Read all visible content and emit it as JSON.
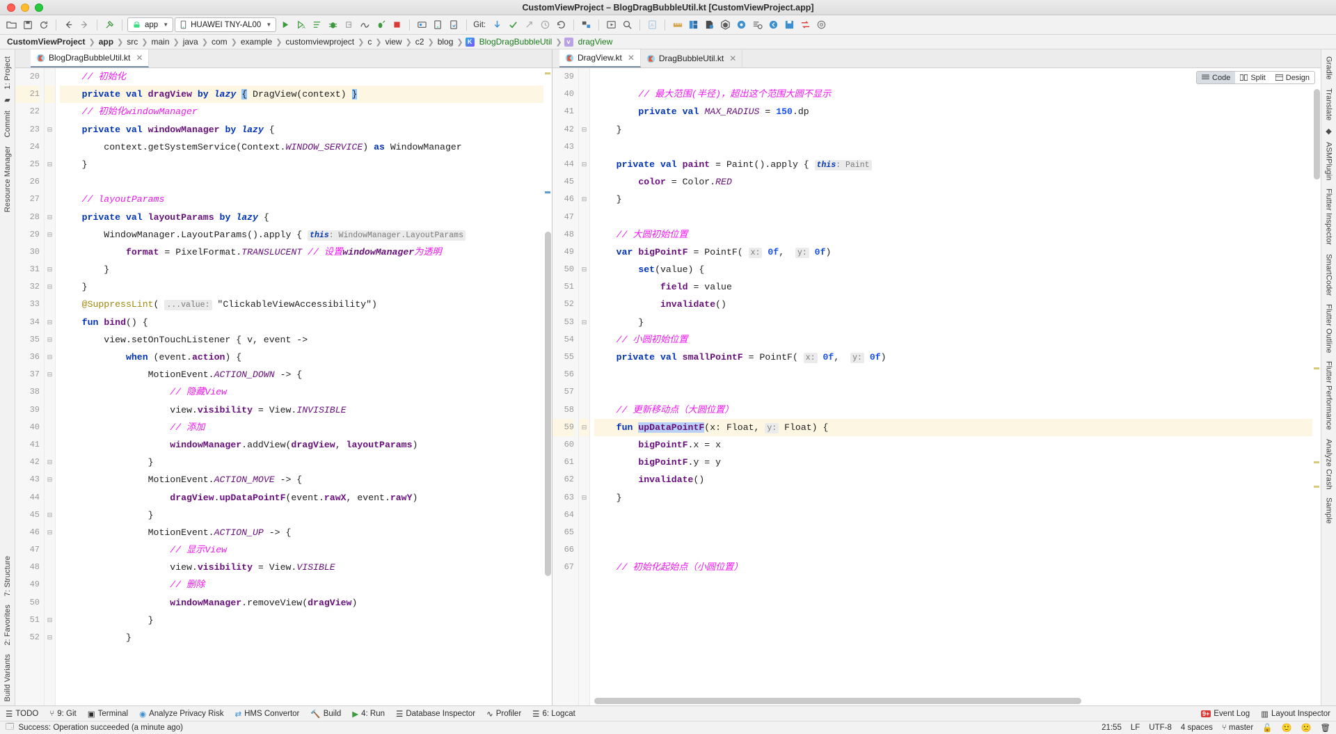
{
  "window": {
    "title": "CustomViewProject – BlogDragBubbleUtil.kt [CustomViewProject.app]"
  },
  "toolbar": {
    "app_config": "app",
    "device": "HUAWEI TNY-AL00",
    "git_label": "Git:",
    "icons": [
      "open-folder-icon",
      "save-all-icon",
      "sync-icon",
      "back-icon",
      "forward-icon",
      "build-hammer-icon",
      "run-icon",
      "run-coverage-icon",
      "run-profile-icon",
      "debug-icon",
      "attach-debugger-icon",
      "profiler-icon",
      "run-with-icon",
      "stop-icon",
      "avd-manager-icon",
      "sdk-manager-icon",
      "device-manager-icon",
      "git-update-icon",
      "git-commit-icon",
      "git-push-icon",
      "git-history-icon",
      "git-revert-icon",
      "project-structure-icon",
      "preview-icon",
      "search-everywhere-icon",
      "layout-editor-icon",
      "ruler-icon",
      "layout-inspector-icon",
      "resource-icon",
      "gradle-icon",
      "help-icon",
      "find-icon",
      "back-nav-icon",
      "save-icon",
      "export-icon",
      "settings-icon"
    ]
  },
  "breadcrumb": {
    "items": [
      {
        "label": "CustomViewProject",
        "bold": true,
        "icon": null
      },
      {
        "label": "app",
        "bold": true,
        "icon": null
      },
      {
        "label": "src",
        "bold": false,
        "icon": null
      },
      {
        "label": "main",
        "bold": false,
        "icon": null
      },
      {
        "label": "java",
        "bold": false,
        "icon": null
      },
      {
        "label": "com",
        "bold": false,
        "icon": null
      },
      {
        "label": "example",
        "bold": false,
        "icon": null
      },
      {
        "label": "customviewproject",
        "bold": false,
        "icon": null
      },
      {
        "label": "c",
        "bold": false,
        "icon": null
      },
      {
        "label": "view",
        "bold": false,
        "icon": null
      },
      {
        "label": "c2",
        "bold": false,
        "icon": null
      },
      {
        "label": "blog",
        "bold": false,
        "icon": null
      },
      {
        "label": "BlogDragBubbleUtil",
        "bold": false,
        "icon": "kotlin-class-icon"
      },
      {
        "label": "dragView",
        "bold": false,
        "icon": "variable-icon"
      }
    ]
  },
  "left_strip": {
    "items": [
      "1: Project",
      "Commit",
      "Resource Manager",
      "7: Structure",
      "2: Favorites",
      "Build Variants"
    ]
  },
  "right_strip": {
    "items": [
      "Gradle",
      "Translate",
      "ASMPlugin",
      "Flutter Inspector",
      "SmartCoder",
      "Flutter Outline",
      "Flutter Performance",
      "Analyze Crash",
      "Sample"
    ]
  },
  "left_pane": {
    "tabs": [
      {
        "label": "BlogDragBubbleUtil.kt",
        "active": true,
        "icon": "kotlin-file-icon"
      }
    ],
    "first_line_number": 20,
    "lines": [
      {
        "n": 20,
        "text": "// 初始化",
        "hl": false
      },
      {
        "n": 21,
        "text": "private val dragView by lazy { DragView(context) }",
        "hl": true
      },
      {
        "n": 22,
        "text": "// 初始化windowManager",
        "hl": false
      },
      {
        "n": 23,
        "text": "private val windowManager by lazy {",
        "hl": false
      },
      {
        "n": 24,
        "text": "context.getSystemService(Context.WINDOW_SERVICE) as WindowManager",
        "hl": false
      },
      {
        "n": 25,
        "text": "}",
        "hl": false
      },
      {
        "n": 26,
        "text": "",
        "hl": false
      },
      {
        "n": 27,
        "text": "// layoutParams",
        "hl": false
      },
      {
        "n": 28,
        "text": "private val layoutParams by lazy {",
        "hl": false
      },
      {
        "n": 29,
        "text": "WindowManager.LayoutParams().apply { this: WindowManager.LayoutParams",
        "hl": false
      },
      {
        "n": 30,
        "text": "format = PixelFormat.TRANSLUCENT // 设置windowManager为透明",
        "hl": false
      },
      {
        "n": 31,
        "text": "}",
        "hl": false
      },
      {
        "n": 32,
        "text": "}",
        "hl": false
      },
      {
        "n": 33,
        "text": "@SuppressLint( ...value: \"ClickableViewAccessibility\")",
        "hl": false
      },
      {
        "n": 34,
        "text": "fun bind() {",
        "hl": false
      },
      {
        "n": 35,
        "text": "view.setOnTouchListener { v, event ->",
        "hl": false
      },
      {
        "n": 36,
        "text": "when (event.action) {",
        "hl": false
      },
      {
        "n": 37,
        "text": "MotionEvent.ACTION_DOWN -> {",
        "hl": false
      },
      {
        "n": 38,
        "text": "// 隐藏View",
        "hl": false
      },
      {
        "n": 39,
        "text": "view.visibility = View.INVISIBLE",
        "hl": false
      },
      {
        "n": 40,
        "text": "// 添加",
        "hl": false
      },
      {
        "n": 41,
        "text": "windowManager.addView(dragView, layoutParams)",
        "hl": false
      },
      {
        "n": 42,
        "text": "}",
        "hl": false
      },
      {
        "n": 43,
        "text": "MotionEvent.ACTION_MOVE -> {",
        "hl": false
      },
      {
        "n": 44,
        "text": "dragView.upDataPointF(event.rawX, event.rawY)",
        "hl": false
      },
      {
        "n": 45,
        "text": "}",
        "hl": false
      },
      {
        "n": 46,
        "text": "MotionEvent.ACTION_UP -> {",
        "hl": false
      },
      {
        "n": 47,
        "text": "// 显示View",
        "hl": false
      },
      {
        "n": 48,
        "text": "view.visibility = View.VISIBLE",
        "hl": false
      },
      {
        "n": 49,
        "text": "// 删除",
        "hl": false
      },
      {
        "n": 50,
        "text": "windowManager.removeView(dragView)",
        "hl": false
      },
      {
        "n": 51,
        "text": "}",
        "hl": false
      },
      {
        "n": 52,
        "text": "}",
        "hl": false
      }
    ]
  },
  "right_pane": {
    "tabs": [
      {
        "label": "DragView.kt",
        "active": true,
        "icon": "kotlin-file-icon"
      },
      {
        "label": "DragBubbleUtil.kt",
        "active": false,
        "icon": "kotlin-file-icon"
      }
    ],
    "view_modes": [
      {
        "label": "Code",
        "selected": true,
        "icon": "code-view-icon"
      },
      {
        "label": "Split",
        "selected": false,
        "icon": "split-view-icon"
      },
      {
        "label": "Design",
        "selected": false,
        "icon": "design-view-icon"
      }
    ],
    "lines": [
      {
        "n": 39,
        "text": "",
        "hl": false
      },
      {
        "n": 40,
        "text": "// 最大范围(半径)，超出这个范围大圆不显示",
        "hl": false
      },
      {
        "n": 41,
        "text": "private val MAX_RADIUS = 150.dp",
        "hl": false
      },
      {
        "n": 42,
        "text": "}",
        "hl": false
      },
      {
        "n": 43,
        "text": "",
        "hl": false
      },
      {
        "n": 44,
        "text": "private val paint = Paint().apply { this: Paint",
        "hl": false
      },
      {
        "n": 45,
        "text": "color = Color.RED",
        "hl": false
      },
      {
        "n": 46,
        "text": "}",
        "hl": false
      },
      {
        "n": 47,
        "text": "",
        "hl": false
      },
      {
        "n": 48,
        "text": "// 大圆初始位置",
        "hl": false
      },
      {
        "n": 49,
        "text": "var bigPointF = PointF( x: 0f,  y: 0f)",
        "hl": false
      },
      {
        "n": 50,
        "text": "set(value) {",
        "hl": false
      },
      {
        "n": 51,
        "text": "field = value",
        "hl": false
      },
      {
        "n": 52,
        "text": "invalidate()",
        "hl": false
      },
      {
        "n": 53,
        "text": "}",
        "hl": false
      },
      {
        "n": 54,
        "text": "// 小圆初始位置",
        "hl": false
      },
      {
        "n": 55,
        "text": "private val smallPointF = PointF( x: 0f,  y: 0f)",
        "hl": false
      },
      {
        "n": 56,
        "text": "",
        "hl": false
      },
      {
        "n": 57,
        "text": "",
        "hl": false
      },
      {
        "n": 58,
        "text": "// 更新移动点（大圆位置）",
        "hl": false
      },
      {
        "n": 59,
        "text": "fun upDataPointF(x: Float, y: Float) {",
        "hl": true
      },
      {
        "n": 60,
        "text": "bigPointF.x = x",
        "hl": false
      },
      {
        "n": 61,
        "text": "bigPointF.y = y",
        "hl": false
      },
      {
        "n": 62,
        "text": "invalidate()",
        "hl": false
      },
      {
        "n": 63,
        "text": "}",
        "hl": false
      },
      {
        "n": 64,
        "text": "",
        "hl": false
      },
      {
        "n": 65,
        "text": "",
        "hl": false
      },
      {
        "n": 66,
        "text": "",
        "hl": false
      },
      {
        "n": 67,
        "text": "// 初始化起始点（小圆位置）",
        "hl": false
      }
    ]
  },
  "tool_windows": {
    "left_items": [
      {
        "label": "TODO",
        "icon": "todo-icon",
        "underline": ""
      },
      {
        "label": "9: Git",
        "icon": "git-icon",
        "underline": "9"
      },
      {
        "label": "Terminal",
        "icon": "terminal-icon",
        "underline": ""
      },
      {
        "label": "Analyze Privacy Risk",
        "icon": "privacy-icon",
        "underline": ""
      },
      {
        "label": "HMS Convertor",
        "icon": "convertor-icon",
        "underline": ""
      },
      {
        "label": "Build",
        "icon": "build-icon",
        "underline": ""
      },
      {
        "label": "4: Run",
        "icon": "run-icon",
        "underline": "4"
      },
      {
        "label": "Database Inspector",
        "icon": "database-icon",
        "underline": ""
      },
      {
        "label": "Profiler",
        "icon": "profiler-icon",
        "underline": ""
      },
      {
        "label": "6: Logcat",
        "icon": "logcat-icon",
        "underline": "6"
      }
    ],
    "right_items": [
      {
        "label": "Event Log",
        "icon": "event-log-icon",
        "badge": "9+"
      },
      {
        "label": "Layout Inspector",
        "icon": "layout-inspector-icon",
        "badge": ""
      }
    ]
  },
  "status_bar": {
    "message": "Success: Operation succeeded (a minute ago)",
    "message_icon": "notification-icon",
    "time": "21:55",
    "line_separator": "LF",
    "encoding": "UTF-8",
    "indent": "4 spaces",
    "branch": "master",
    "branch_icon": "vcs-branch-icon",
    "lock_icon": "lock-icon",
    "face_icons": [
      "happy-face-icon",
      "sad-face-icon"
    ],
    "trash_icon": "memory-indicator-icon"
  },
  "colors": {
    "accent_green": "#3c9a3c",
    "keyword_blue": "#0033b3",
    "comment_magenta": "#ef18ef",
    "string_green": "#067d17",
    "field_purple": "#660e7a",
    "number_blue": "#1750eb",
    "highlight_line": "#fdf6e3",
    "selection_blue": "#b8d0f7"
  }
}
